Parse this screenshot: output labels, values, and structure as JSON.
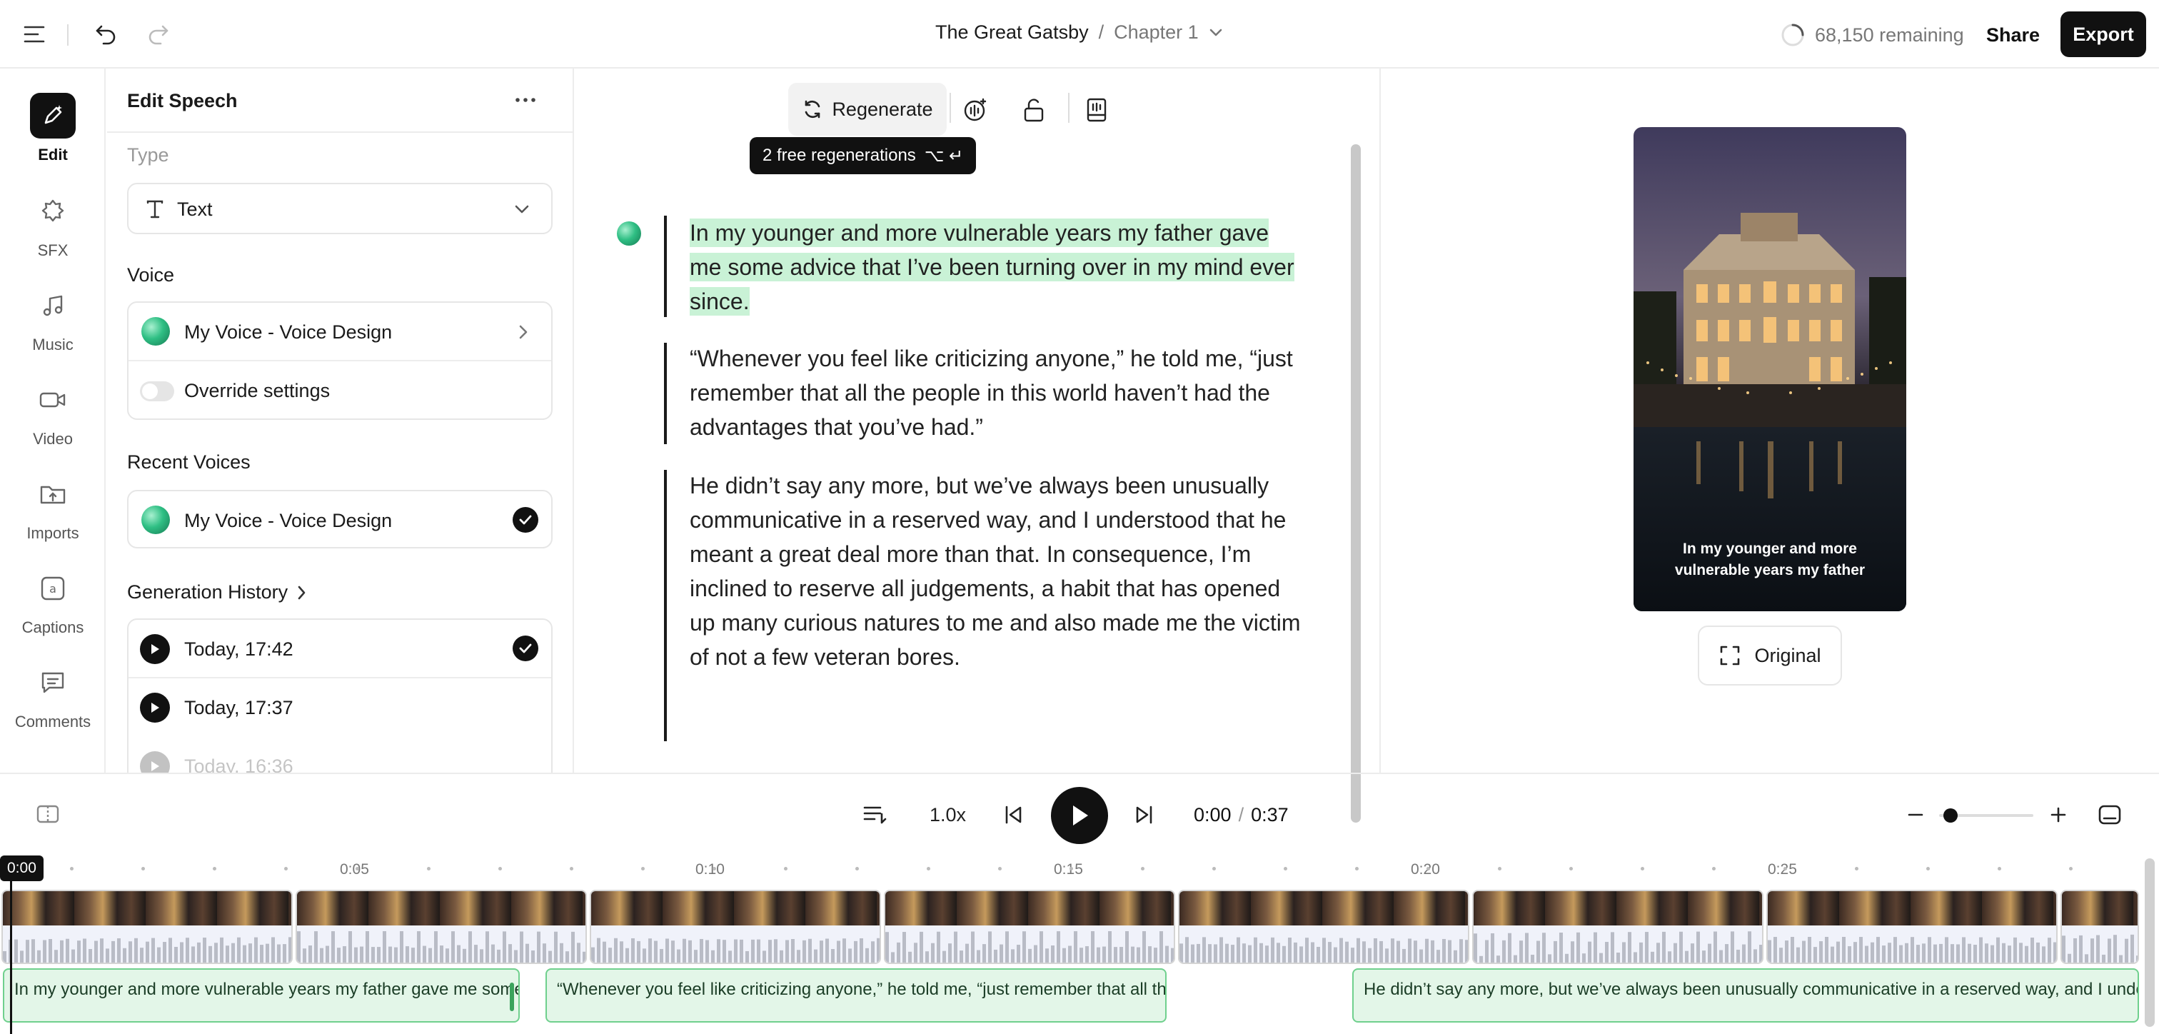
{
  "topbar": {
    "project": "The Great Gatsby",
    "separator": "/",
    "chapter": "Chapter 1",
    "remaining": "68,150 remaining",
    "share": "Share",
    "export": "Export"
  },
  "rail": [
    {
      "label": "Edit",
      "icon": "pen-sparkle-icon",
      "active": true
    },
    {
      "label": "SFX",
      "icon": "sfx-icon"
    },
    {
      "label": "Music",
      "icon": "music-note-icon"
    },
    {
      "label": "Video",
      "icon": "video-camera-icon"
    },
    {
      "label": "Imports",
      "icon": "folder-upload-icon"
    },
    {
      "label": "Captions",
      "icon": "captions-icon"
    },
    {
      "label": "Comments",
      "icon": "comment-icon"
    }
  ],
  "panel": {
    "title": "Edit Speech",
    "type_label": "Type",
    "type_value": "Text",
    "voice_label": "Voice",
    "voice_name": "My Voice - Voice Design",
    "override_label": "Override settings",
    "override_on": false,
    "recent_label": "Recent Voices",
    "recent_voice": "My Voice - Voice Design",
    "history_label": "Generation History",
    "history": [
      {
        "time": "Today, 17:42",
        "selected": true
      },
      {
        "time": "Today, 17:37",
        "selected": false
      },
      {
        "time": "Today, 16:36",
        "selected": false
      }
    ]
  },
  "editor": {
    "regenerate": "Regenerate",
    "tooltip": "2 free regenerations",
    "tooltip_keys": "⌥ ↵",
    "paragraphs": [
      "In my younger and more vulnerable years my father gave me some advice that I’ve been turning over in my mind ever since.",
      "“Whenever you feel like criticizing anyone,” he told me, “just remember that all the people in this world haven’t had the advantages that you’ve had.”",
      "He didn’t say any more, but we’ve always been unusually communicative in a reserved way, and I understood that he meant a great deal more than that. In consequence, I’m inclined to reserve all judgements, a habit that has opened up many curious natures to me and also made me the victim of not a few veteran bores."
    ]
  },
  "preview": {
    "caption": "In my younger and more vulnerable years my father",
    "original": "Original"
  },
  "player": {
    "speed": "1.0x",
    "current": "0:00",
    "separator": "/",
    "total": "0:37",
    "zoom_level": 0.05
  },
  "timeline": {
    "ruler": [
      "0:05",
      "0:10",
      "0:15",
      "0:20",
      "0:25"
    ],
    "playhead": "0:00",
    "captions": [
      "In my younger and more vulnerable years my father gave me some advice",
      "“Whenever you feel like criticizing anyone,” he told me, “just remember that all the people",
      "He didn’t say any more, but we’ve always been unusually communicative in a reserved way, and I understood"
    ]
  },
  "colors": {
    "accent_dark": "#111111",
    "highlight": "#c9f2d6",
    "caption_clip": "#e3f6e8",
    "caption_border": "#6fd08d"
  }
}
